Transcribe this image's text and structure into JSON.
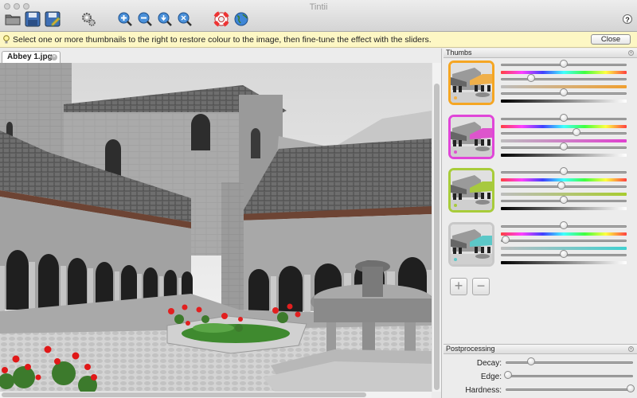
{
  "window": {
    "title": "Tintii"
  },
  "toolbar": {
    "buttons": [
      {
        "name": "open-button",
        "icon": "folder-icon"
      },
      {
        "name": "save-button",
        "icon": "floppy-icon"
      },
      {
        "name": "save-as-button",
        "icon": "floppy-pencil-icon"
      },
      {
        "name": "settings-button",
        "icon": "gears-icon"
      },
      {
        "name": "zoom-in-button",
        "icon": "zoom-in-icon"
      },
      {
        "name": "zoom-out-button",
        "icon": "zoom-out-icon"
      },
      {
        "name": "zoom-fit-button",
        "icon": "zoom-fit-icon"
      },
      {
        "name": "zoom-actual-button",
        "icon": "zoom-actual-icon"
      },
      {
        "name": "help-lifebuoy-button",
        "icon": "lifebuoy-icon"
      },
      {
        "name": "web-button",
        "icon": "globe-icon"
      }
    ],
    "help_label": "?"
  },
  "infobar": {
    "text": "Select one or more thumbnails to the right to restore colour to the image, then fine-tune the effect with the sliders.",
    "close_label": "Close"
  },
  "document": {
    "tab_label": "Abbey 1.jpg",
    "tab_close": "×"
  },
  "thumbs_panel": {
    "title": "Thumbs",
    "close_label": "×",
    "items": [
      {
        "border": "#f5a623",
        "accent": "#f0b04a",
        "hue_level": 0.5,
        "sat_level": 0.24,
        "bright_level": 0.5,
        "hue_strip": "#f0a030"
      },
      {
        "border": "#e046d8",
        "accent": "#dd55cc",
        "hue_level": 0.5,
        "sat_level": 0.6,
        "bright_level": 0.5,
        "hue_strip": "#e040d0"
      },
      {
        "border": "#a8cc3a",
        "accent": "#a7c93e",
        "hue_level": 0.5,
        "sat_level": 0.48,
        "bright_level": 0.5,
        "hue_strip": "#a8cc30"
      },
      {
        "border": "#c8c8c8",
        "accent": "#5cc8c8",
        "hue_level": 0.5,
        "sat_level": 0.04,
        "bright_level": 0.5,
        "hue_strip": "#40d0d0"
      }
    ],
    "add_label": "+",
    "remove_label": "−"
  },
  "postprocessing": {
    "title": "Postprocessing",
    "close_label": "×",
    "rows": [
      {
        "label": "Decay:",
        "level": 0.2
      },
      {
        "label": "Edge:",
        "level": 0.02
      },
      {
        "label": "Hardness:",
        "level": 0.98
      }
    ]
  }
}
